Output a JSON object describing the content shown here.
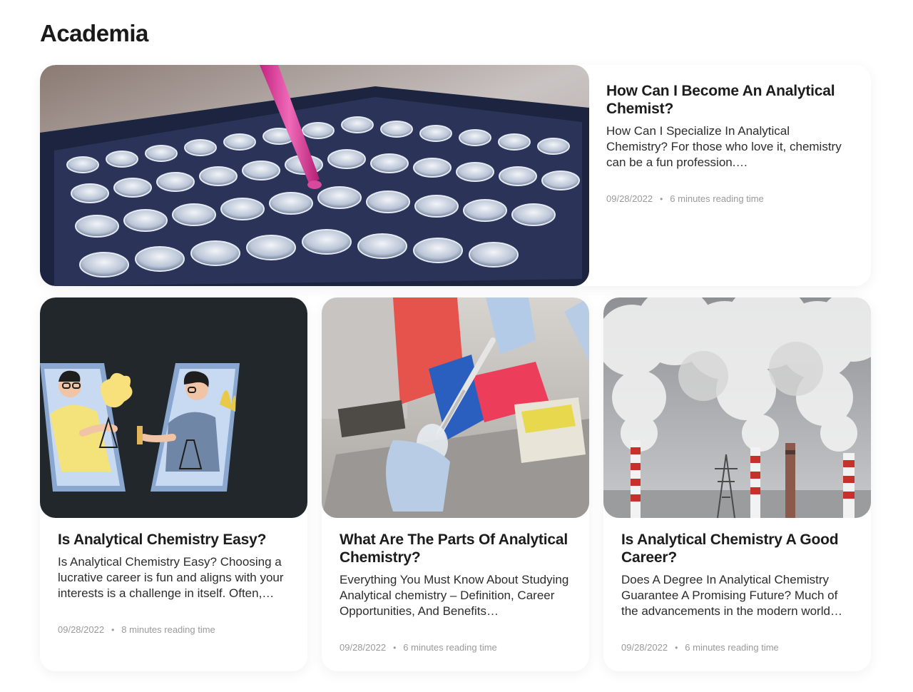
{
  "section": {
    "title": "Academia"
  },
  "featured": {
    "title": "How Can I Become An Analytical Chemist?",
    "excerpt": "How Can I Specialize In Analytical Chemistry? For those who love it, chemistry can be a fun profession.…",
    "date": "09/28/2022",
    "reading": "6 minutes reading time"
  },
  "cards": [
    {
      "title": "Is Analytical Chemistry Easy?",
      "excerpt": "Is Analytical Chemistry Easy? Choosing a lucrative career is fun and aligns with your interests is a challenge in itself. Often,…",
      "date": "09/28/2022",
      "reading": "8 minutes reading time"
    },
    {
      "title": "What Are The Parts Of Analytical Chemistry?",
      "excerpt": "Everything You Must Know About Studying Analytical chemistry – Definition, Career Opportunities, And Benefits…",
      "date": "09/28/2022",
      "reading": "6 minutes reading time"
    },
    {
      "title": "Is Analytical Chemistry A Good Career?",
      "excerpt": "Does A Degree In Analytical Chemistry Guarantee A Promising Future? Much of the advancements in the modern world…",
      "date": "09/28/2022",
      "reading": "6 minutes reading time"
    }
  ],
  "meta_separator": "•",
  "colors": {
    "dark_bg": "#22272b",
    "accent_pink": "#e0449a"
  }
}
